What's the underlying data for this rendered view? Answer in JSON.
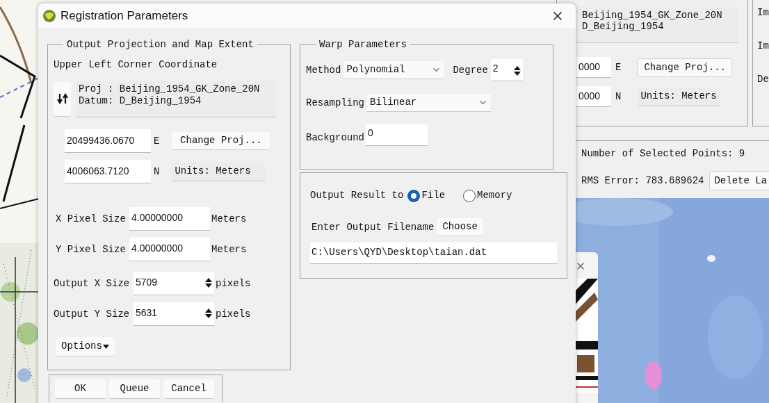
{
  "dialog": {
    "title": "Registration Parameters"
  },
  "output_projection": {
    "legend": "Output Projection and Map Extent",
    "heading": "Upper Left Corner Coordinate",
    "projection_lines": [
      "Proj : Beijing_1954_GK_Zone_20N",
      "Datum: D_Beijing_1954"
    ],
    "easting": {
      "value": "20499436.0670",
      "unit": "E"
    },
    "change_projection_button": "Change Proj...",
    "northing": {
      "value": "4006063.7120",
      "unit": "N"
    },
    "units_label": "Units: Meters",
    "pixel_sizes": [
      {
        "label": "X Pixel Size",
        "value": "4.00000000",
        "unit": "Meters"
      },
      {
        "label": "Y Pixel Size",
        "value": "4.00000000",
        "unit": "Meters"
      }
    ],
    "output_sizes": [
      {
        "label": "Output X Size",
        "value": "5709",
        "unit": "pixels"
      },
      {
        "label": "Output Y Size",
        "value": "5631",
        "unit": "pixels"
      }
    ],
    "options_button": "Options"
  },
  "warp_parameters": {
    "legend": "Warp Parameters",
    "method": {
      "label": "Method",
      "value": "Polynomial"
    },
    "degree": {
      "label": "Degree",
      "value": "2"
    },
    "resampling": {
      "label": "Resampling",
      "value": "Bilinear"
    },
    "background": {
      "label": "Background",
      "value": "0"
    }
  },
  "output_result": {
    "label": "Output Result to",
    "options": [
      {
        "label": "File",
        "selected": true
      },
      {
        "label": "Memory",
        "selected": false
      }
    ],
    "filename_label": "Enter Output Filename",
    "choose_button": "Choose",
    "filename": "C:\\Users\\QYD\\Desktop\\taian.dat"
  },
  "buttons": [
    "OK",
    "Queue",
    "Cancel"
  ],
  "background_window": {
    "projection_lines": [
      "Beijing_1954_GK_Zone_20N",
      "D_Beijing_1954"
    ],
    "easting": {
      "value": "0000",
      "unit": "E"
    },
    "change_projection_button": "Change Proj...",
    "northing": {
      "value": "0000",
      "unit": "N"
    },
    "units_label": "Units: Meters",
    "side_labels": [
      "Im",
      "Im",
      "De"
    ],
    "selected_points": "Number of Selected Points: 9",
    "rms_error": "RMS Error: 783.689624",
    "delete_button": "Delete La"
  }
}
